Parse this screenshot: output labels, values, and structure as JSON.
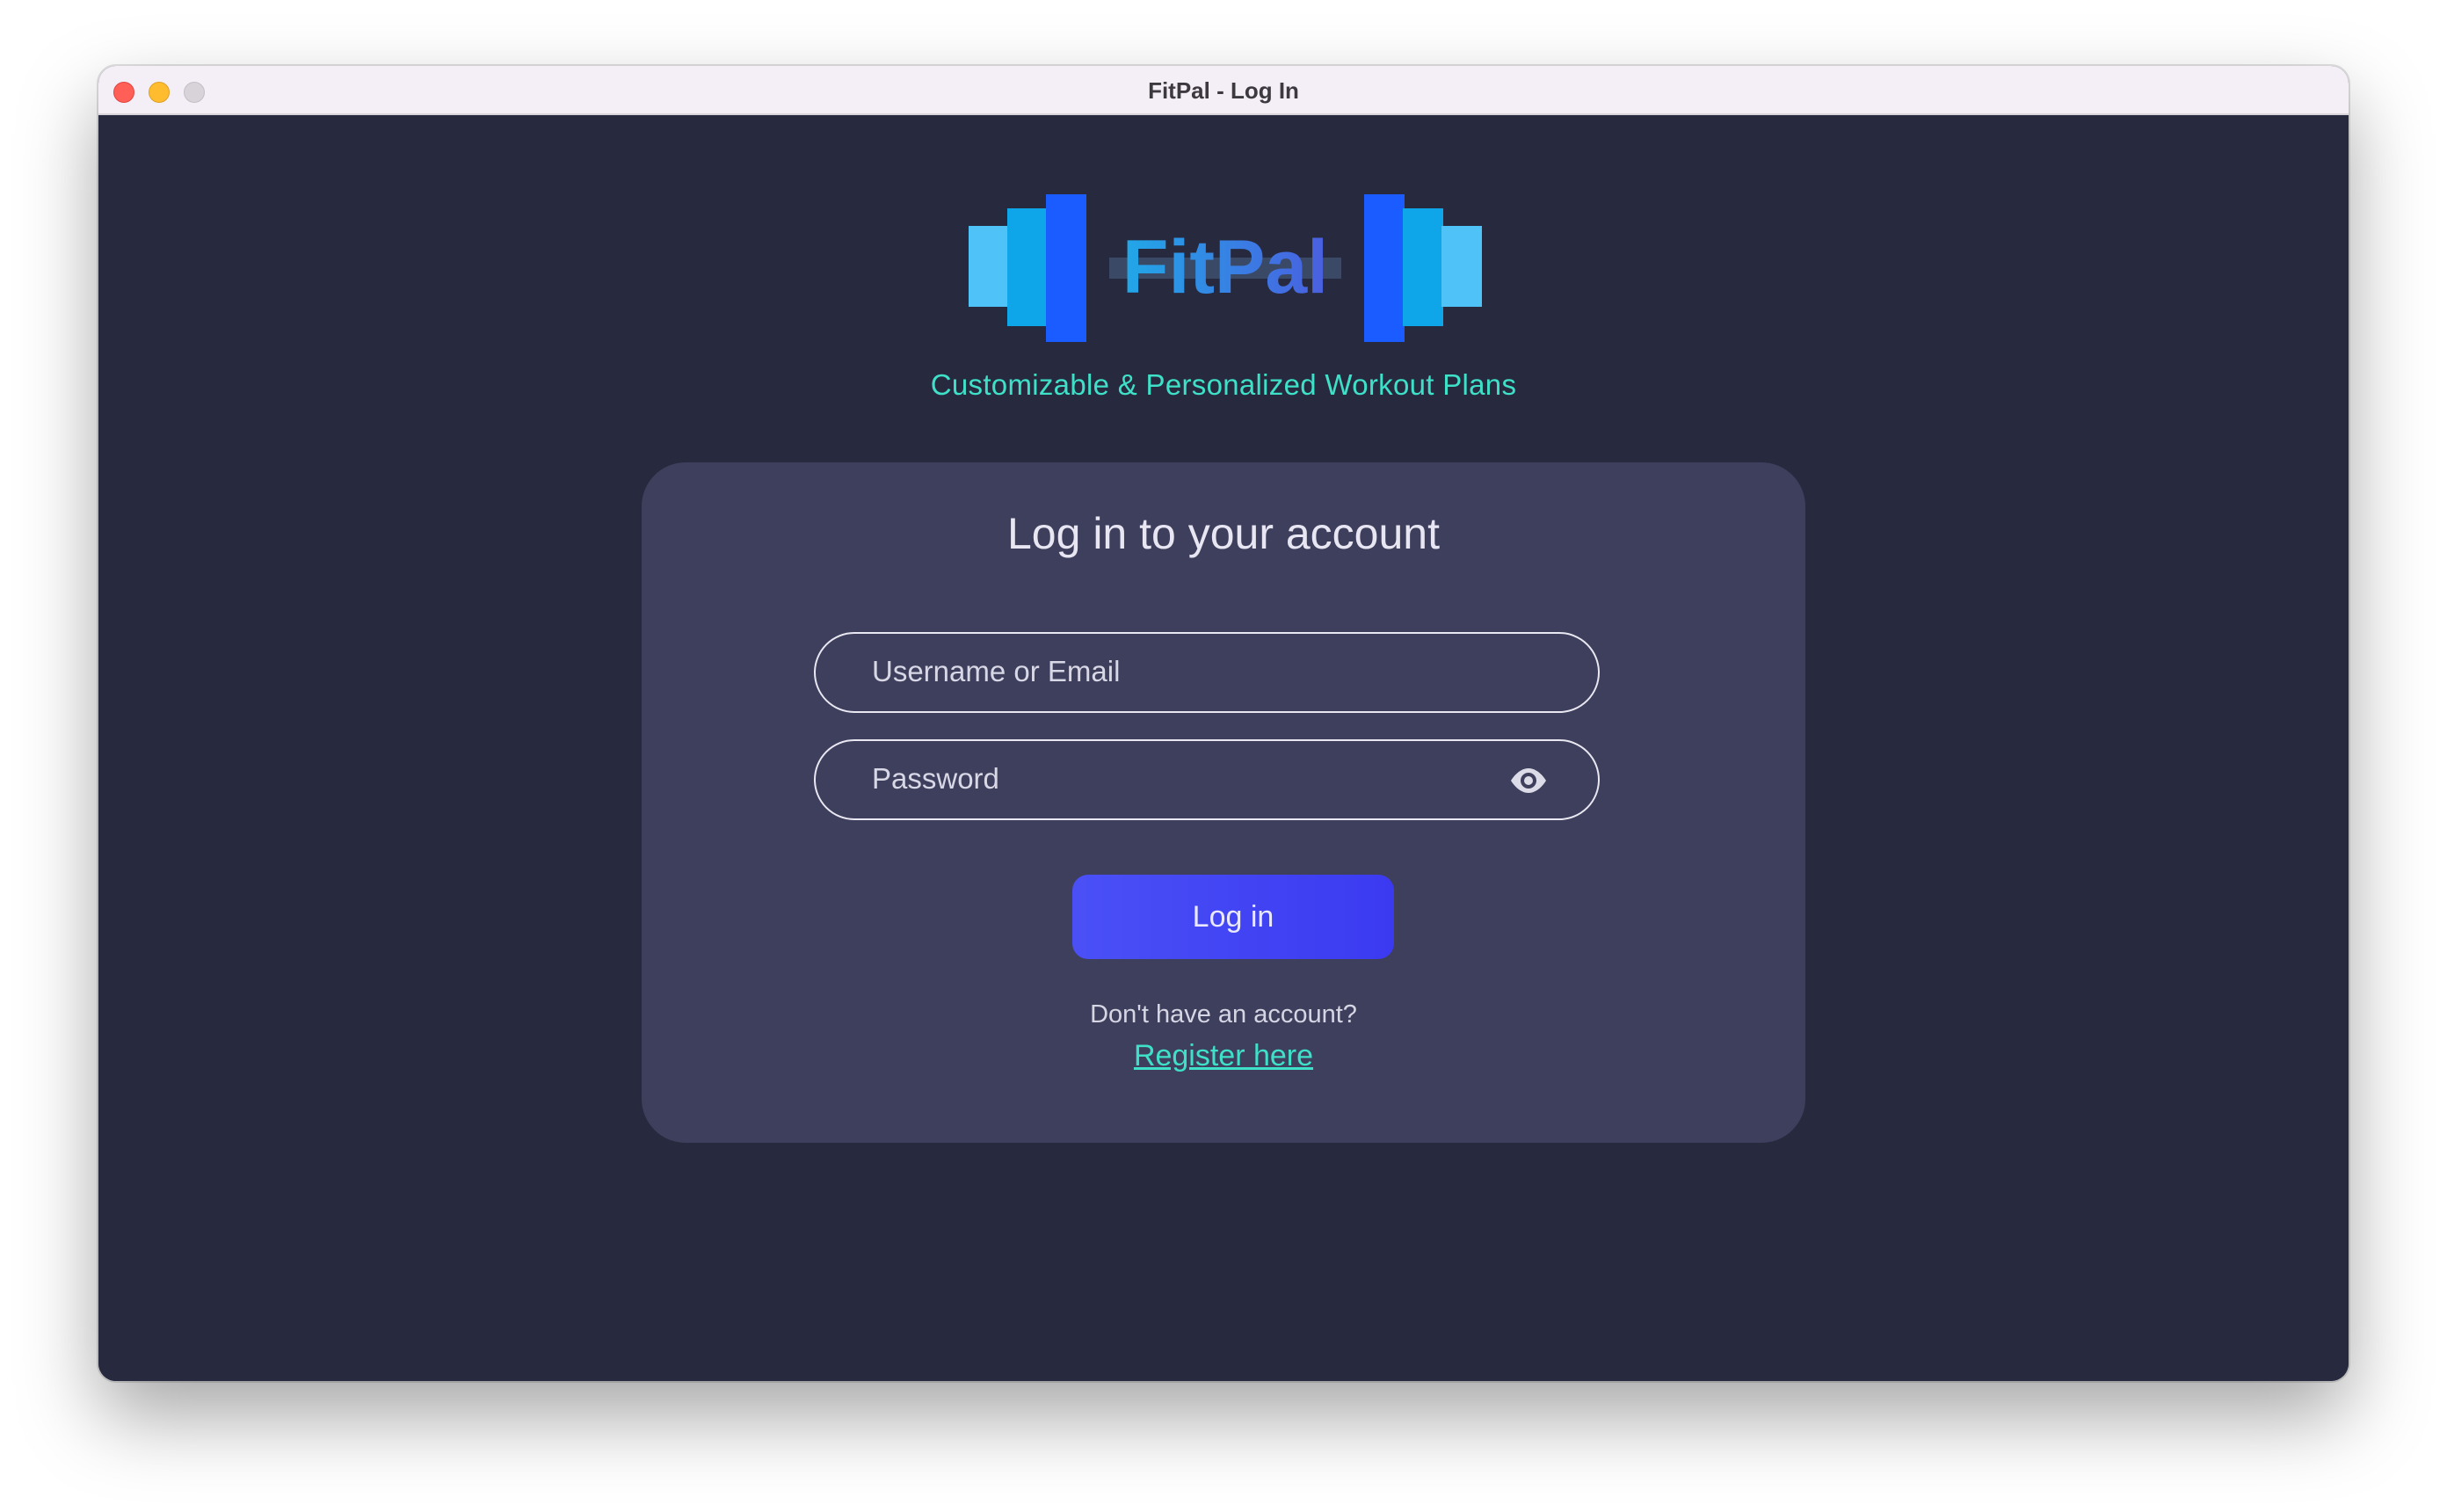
{
  "window": {
    "title": "FitPal - Log In"
  },
  "brand": {
    "logo_text": "FitPal",
    "tagline": "Customizable & Personalized Workout Plans",
    "colors": {
      "accent_teal": "#3fe0c8",
      "plate_blue_dark": "#1a5cff",
      "plate_blue_mid": "#0ea5e9",
      "plate_blue_light": "#4fc3f7",
      "background": "#272a3f",
      "card": "#3e3f5d",
      "button": "#4348f4"
    }
  },
  "login": {
    "heading": "Log in to your account",
    "username_placeholder": "Username or Email",
    "password_placeholder": "Password",
    "password_toggle_icon": "eye-icon",
    "submit_label": "Log in",
    "no_account_text": "Don't have an account?",
    "register_label": "Register here"
  }
}
